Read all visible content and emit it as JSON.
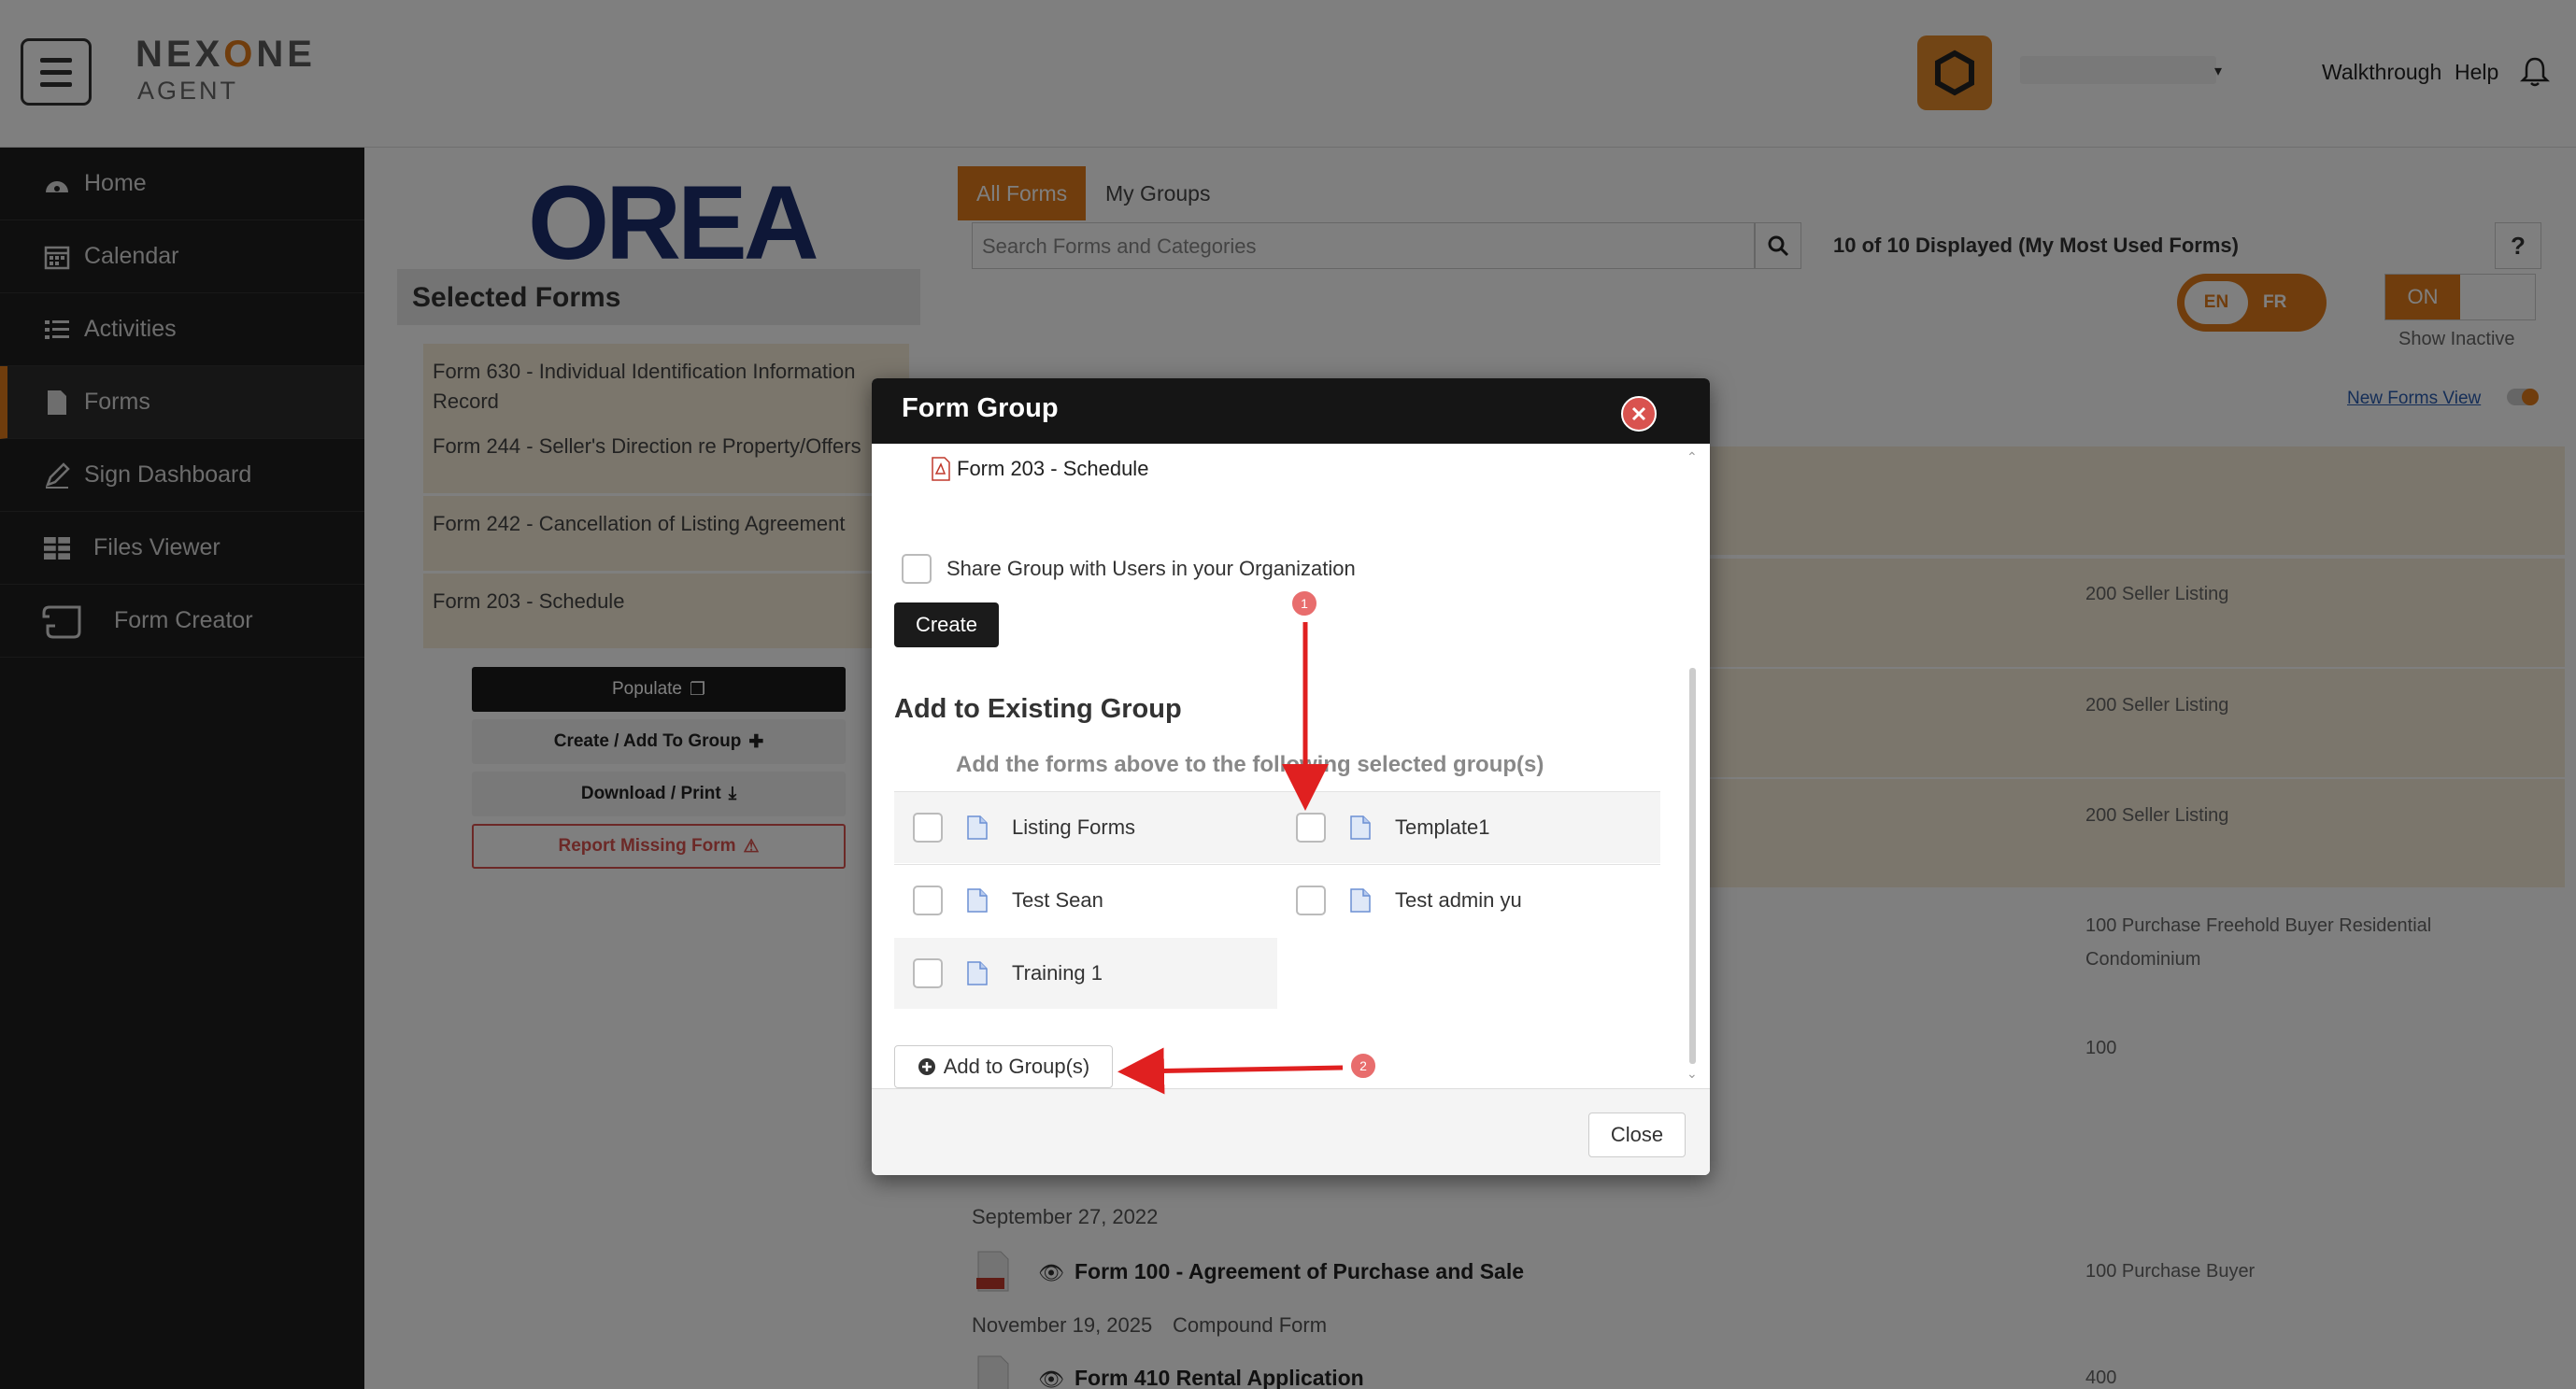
{
  "header": {
    "brand": "NEXONE",
    "brand_sub": "AGENT",
    "walkthrough": "Walkthrough",
    "help": "Help"
  },
  "sidebar": {
    "items": [
      {
        "label": "Home",
        "icon": "dashboard-icon"
      },
      {
        "label": "Calendar",
        "icon": "calendar-icon"
      },
      {
        "label": "Activities",
        "icon": "list-icon"
      },
      {
        "label": "Forms",
        "icon": "document-icon"
      },
      {
        "label": "Sign Dashboard",
        "icon": "pen-icon"
      },
      {
        "label": "Files Viewer",
        "icon": "grid-icon"
      },
      {
        "label": "Form Creator",
        "icon": "scroll-icon"
      }
    ]
  },
  "left_panel": {
    "org_logo": "OREA",
    "selected_title": "Selected Forms",
    "selected_forms": [
      "Form 630 - Individual Identification Information Record",
      "Form 244 - Seller's Direction re Property/Offers",
      "Form 242 - Cancellation of Listing Agreement",
      "Form 203 - Schedule"
    ],
    "populate_label": "Populate",
    "create_group_label": "Create / Add To Group",
    "download_label": "Download / Print",
    "report_label": "Report Missing Form"
  },
  "main": {
    "tabs": [
      "All Forms",
      "My Groups"
    ],
    "search_placeholder": "Search Forms and Categories",
    "displayed_text": "10 of 10 Displayed (My Most Used Forms)",
    "help_q": "?",
    "lang_en": "EN",
    "lang_fr": "FR",
    "inactive_on": "ON",
    "show_inactive": "Show Inactive",
    "new_forms_view": "New Forms View",
    "rows": [
      {
        "tags": "200   Seller   Listing"
      },
      {
        "tags": "200   Seller   Listing"
      },
      {
        "tags": "200   Seller   Listing"
      },
      {
        "tags": "100   Purchase   Freehold   Buyer   Residential",
        "tags2": "Condominium"
      },
      {
        "tags": "100"
      }
    ],
    "date1": "September 27, 2022",
    "form100_title": "Form 100 - Agreement of Purchase and Sale",
    "form100_tags": "100   Purchase   Buyer",
    "date2": "November 19, 2025",
    "compound": "Compound Form",
    "form410_title": "Form 410 Rental Application",
    "form410_tags": "400"
  },
  "modal": {
    "title": "Form Group",
    "form_item": "Form 203 - Schedule",
    "share_label": "Share Group with Users in your Organization",
    "create_label": "Create",
    "existing_title": "Add to Existing Group",
    "existing_sub": "Add the forms above to the following selected group(s)",
    "groups": [
      "Listing Forms",
      "Template1",
      "Test Sean",
      "Test admin yu",
      "Training 1"
    ],
    "add_button": "Add to Group(s)",
    "close_label": "Close"
  },
  "annotations": {
    "badge1": "1",
    "badge2": "2",
    "arrow_color": "#e02020"
  }
}
